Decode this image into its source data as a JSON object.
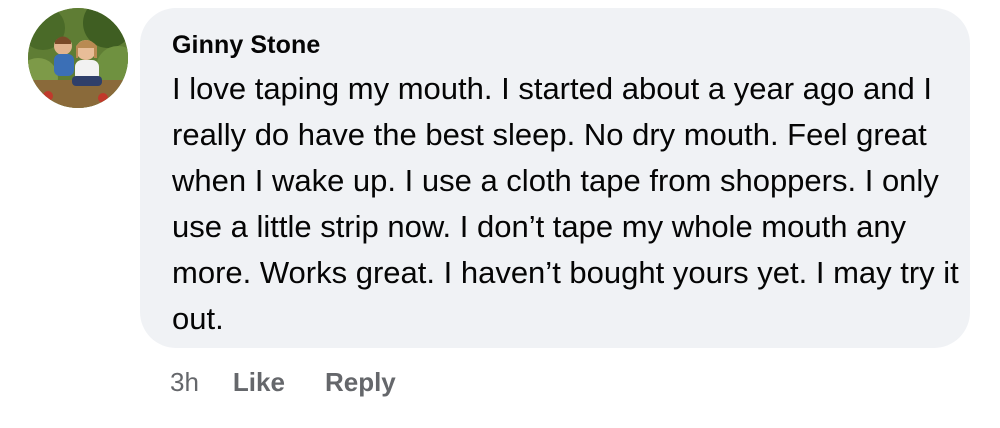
{
  "comment": {
    "author": "Ginny Stone",
    "text": "I love taping my mouth. I started about a year ago and I really do have the best sleep. No dry mouth. Feel great when I wake up. I use a cloth tape from shoppers. I only use a little strip now. I don’t tape my whole mouth any more. Works great. I haven’t bought yours yet. I may try it out.",
    "timestamp": "3h",
    "like_label": "Like",
    "reply_label": "Reply",
    "avatar_icon": "profile-photo-icon"
  },
  "colors": {
    "bubble_background": "#f0f2f5",
    "text": "#050505",
    "secondary_text": "#65676b"
  }
}
